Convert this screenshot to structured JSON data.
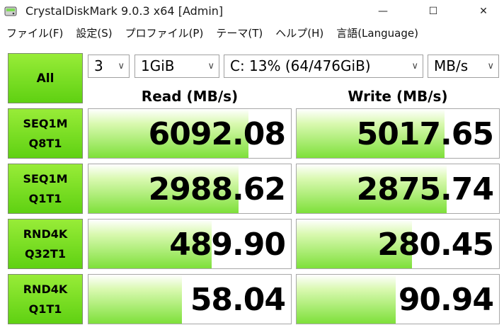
{
  "window": {
    "title": "CrystalDiskMark 9.0.3 x64 [Admin]",
    "minimize_glyph": "—",
    "maximize_glyph": "☐",
    "close_glyph": "✕",
    "icon": "disk-icon"
  },
  "menu": [
    "ファイル(F)",
    "設定(S)",
    "プロファイル(P)",
    "テーマ(T)",
    "ヘルプ(H)",
    "言語(Language)"
  ],
  "controls": {
    "all_label": "All",
    "count": "3",
    "size": "1GiB",
    "drive": "C: 13% (64/476GiB)",
    "unit": "MB/s"
  },
  "headers": {
    "read": "Read (MB/s)",
    "write": "Write (MB/s)"
  },
  "rows": [
    {
      "line1": "SEQ1M",
      "line2": "Q8T1",
      "read": "6092.08",
      "write": "5017.65",
      "read_level": 0.79,
      "write_level": 0.73
    },
    {
      "line1": "SEQ1M",
      "line2": "Q1T1",
      "read": "2988.62",
      "write": "2875.74",
      "read_level": 0.74,
      "write_level": 0.74
    },
    {
      "line1": "RND4K",
      "line2": "Q32T1",
      "read": "489.90",
      "write": "280.45",
      "read_level": 0.61,
      "write_level": 0.57
    },
    {
      "line1": "RND4K",
      "line2": "Q1T1",
      "read": "58.04",
      "write": "90.94",
      "read_level": 0.46,
      "write_level": 0.49
    }
  ],
  "colors": {
    "button_green": "#6fd81a",
    "fill_green": "#7ee03a",
    "border": "#a8a8a8"
  }
}
